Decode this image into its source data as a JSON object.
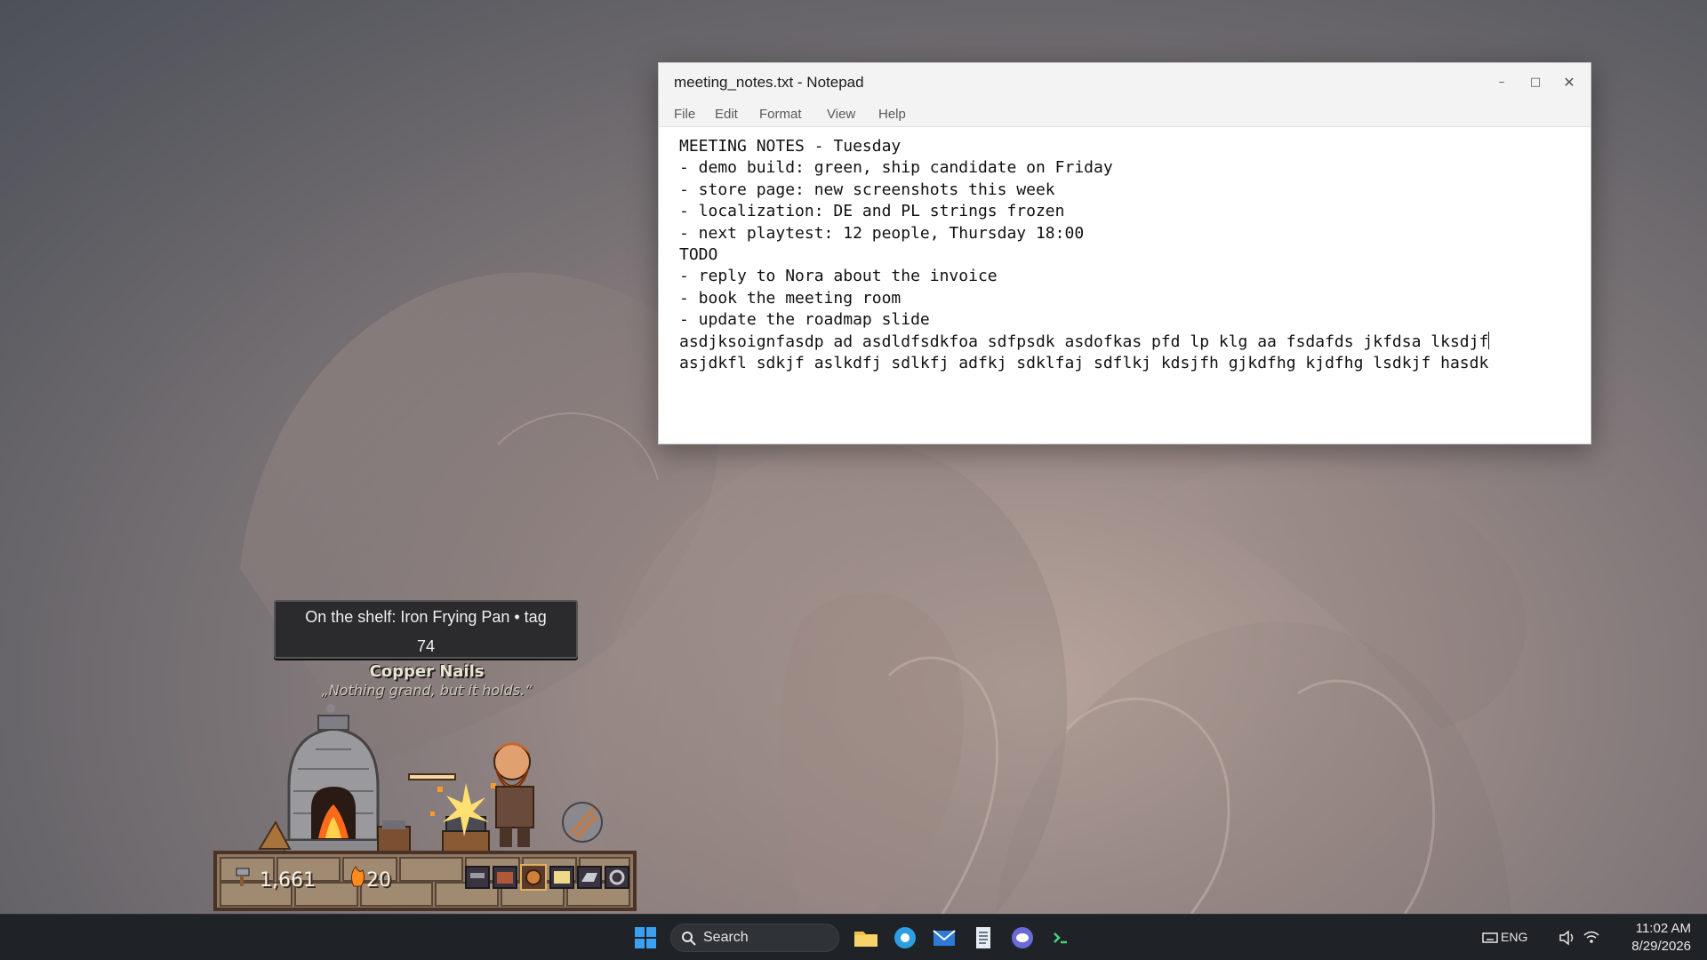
{
  "notepad": {
    "title": "meeting_notes.txt - Notepad",
    "controls": {
      "minimize": "–",
      "maximize": "□",
      "close": "✕"
    },
    "menu": [
      "File",
      "Edit",
      "Format",
      "View",
      "Help"
    ],
    "lines": [
      "MEETING NOTES - Tuesday",
      "",
      "- demo build: green, ship candidate on Friday",
      "- store page: new screenshots this week",
      "- localization: DE and PL strings frozen",
      "- next playtest: 12 people, Thursday 18:00",
      "",
      "TODO",
      "- reply to Nora about the invoice",
      "- book the meeting room",
      "- update the roadmap slide",
      "",
      "asdjksoignfasdp ad asdldfsdkfoa sdfpsdk asdofkas pfd lp klg aa fsdafds jkfdsa lksdjf",
      "asjdkfl sdkjf aslkdfj sdlkfj adfkj sdklfaj sdflkj kdsjfh gjkdfhg kjdfhg lsdkjf hasdk"
    ]
  },
  "game": {
    "tooltip_line1": "On the shelf: Iron Frying Pan • tag",
    "tooltip_line2": "74",
    "shop_name": "Copper Nails",
    "shop_motto": "„Nothing grand, but it holds.“",
    "coins": "1,661",
    "fame": "20",
    "toolbar_icons": [
      "anvil-icon",
      "chest-icon",
      "target-icon",
      "book-icon",
      "ingot-icon",
      "gear-icon"
    ],
    "colors": {
      "stone": "#8a7a6a",
      "frame": "#5a3d2e",
      "fire": "#ff8a1e"
    }
  },
  "taskbar": {
    "search_label": "Search",
    "icons": [
      "start-icon",
      "search-icon",
      "file-explorer-icon",
      "browser-icon",
      "mail-icon",
      "notepad-icon",
      "chat-icon",
      "terminal-icon"
    ],
    "tray_lang": "ENG",
    "tray_icons": [
      "keyboard-icon",
      "volume-icon",
      "wifi-icon"
    ],
    "time": "11:02 AM",
    "date": "8/29/2026"
  }
}
